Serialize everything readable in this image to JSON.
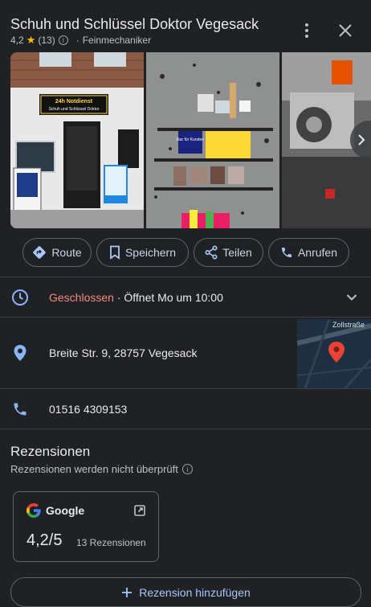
{
  "header": {
    "title": "Schuh und Schlüssel Doktor Vegesack",
    "rating": "4,2",
    "review_count": "(13)",
    "category": "Feinmechaniker"
  },
  "photos": {
    "photo1_sign_line1": "24h Notdienst",
    "photo1_sign_line2": "Schuh und Schlüssel Doktor",
    "photo2_label1": "Nur für Kunden"
  },
  "actions": [
    {
      "label": "Route",
      "icon": "directions-icon"
    },
    {
      "label": "Speichern",
      "icon": "bookmark-icon"
    },
    {
      "label": "Teilen",
      "icon": "share-icon"
    },
    {
      "label": "Anrufen",
      "icon": "phone-icon"
    }
  ],
  "hours": {
    "status": "Geschlossen",
    "separator": " · ",
    "next": "Öffnet Mo um 10:00"
  },
  "address": {
    "text": "Breite Str. 9, 28757 Vegesack",
    "map_street_label": "Zollstraße"
  },
  "phone": {
    "text": "01516 4309153"
  },
  "reviews": {
    "title": "Rezensionen",
    "subtitle": "Rezensionen werden nicht überprüft",
    "source": "Google",
    "score": "4,2/5",
    "count": "13 Rezensionen",
    "add_label": "Rezension hinzufügen"
  },
  "colors": {
    "background": "#202124",
    "accent": "#a8c7fa",
    "closed": "#f28b82",
    "star": "#fbbc04"
  }
}
